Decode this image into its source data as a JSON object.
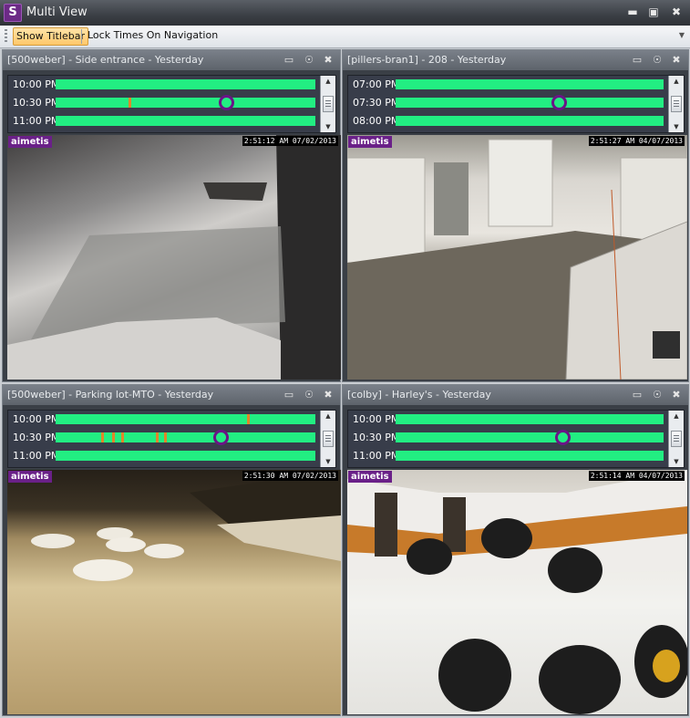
{
  "window": {
    "title": "Multi View",
    "app_icon": "S",
    "controls": [
      "minimize-icon",
      "maximize-icon",
      "close-icon"
    ]
  },
  "toolbar": {
    "show_titlebar_label": "Show Titlebar",
    "lock_times_label": "Lock Times On Navigation"
  },
  "panes": [
    {
      "title": "[500weber] - Side entrance - Yesterday",
      "times": [
        "10:00 PM",
        "10:30 PM",
        "11:00 PM"
      ],
      "watermark": "aimetis",
      "timestamp": "2:51:12 AM 07/02/2013",
      "scene": "snowy side entrance at night"
    },
    {
      "title": "[pillers-bran1] - 208 - Yesterday",
      "times": [
        "07:00 PM",
        "07:30 PM",
        "08:00 PM"
      ],
      "watermark": "aimetis",
      "timestamp": "2:51:27 AM 04/07/2013",
      "scene": "loading dock with garage doors"
    },
    {
      "title": "[500weber] - Parking lot-MTO - Yesterday",
      "times": [
        "10:00 PM",
        "10:30 PM",
        "11:00 PM"
      ],
      "watermark": "aimetis",
      "timestamp": "2:51:30 AM 07/02/2013",
      "scene": "snowy parking lot at night"
    },
    {
      "title": "[colby] - Harley's - Yesterday",
      "times": [
        "10:00 PM",
        "10:30 PM",
        "11:00 PM"
      ],
      "watermark": "aimetis",
      "timestamp": "2:51:14 AM 04/07/2013",
      "scene": "motorcycle showroom"
    }
  ],
  "colors": {
    "timeline_fill": "#22ee82",
    "event_marker": "#e0862a",
    "position_ring": "#6b1487",
    "toolbar_highlight": "#ffc86a"
  }
}
